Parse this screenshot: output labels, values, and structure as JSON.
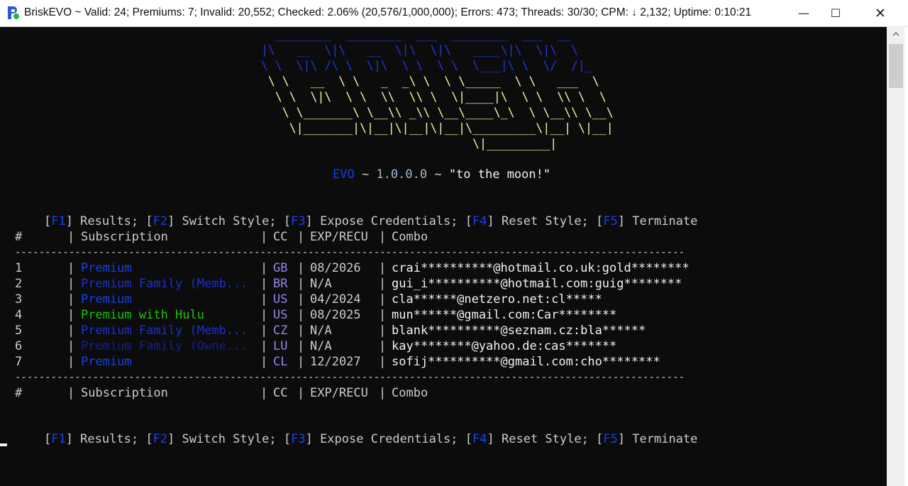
{
  "window": {
    "title": "BriskEVO ~ Valid: 24; Premiums: 7; Invalid: 20,552; Checked: 2.06% (20,576/1,000,000); Errors: 473; Threads: 30/30; CPM: ↓ 2,132; Uptime: 0:10:21",
    "minimize": "—",
    "maximize": "☐",
    "close": "✕"
  },
  "art": {
    "line1": "  ________  ________  ___  ________  ___  __",
    "line2": "|\\   __  \\|\\   __  \\|\\  \\|\\   ____\\|\\  \\|\\  \\",
    "line3": "\\ \\  \\|\\ /\\ \\  \\|\\  \\ \\  \\ \\  \\___|\\ \\  \\/  /|_",
    "line4": " \\ \\   __  \\ \\   _  _\\ \\  \\ \\_____  \\ \\   ___  \\",
    "line5": "  \\ \\  \\|\\  \\ \\  \\\\  \\\\ \\  \\|____|\\  \\ \\  \\\\ \\  \\",
    "line6": "   \\ \\_______\\ \\__\\\\ _\\\\ \\__\\____\\_\\  \\ \\__\\\\ \\__\\",
    "line7": "    \\|_______|\\|__|\\|__|\\|__|\\_________\\|__| \\|__|",
    "line8": "                              \\|_________|"
  },
  "version_line": {
    "evo": "EVO",
    "sep1": " ~ ",
    "version": "1.0.0.0",
    "sep2": " ~ ",
    "motto": "\"to the moon!\""
  },
  "menu": [
    {
      "key": "F1",
      "label": "Results;"
    },
    {
      "key": "F2",
      "label": "Switch Style;"
    },
    {
      "key": "F3",
      "label": "Expose Credentials;"
    },
    {
      "key": "F4",
      "label": "Reset Style;"
    },
    {
      "key": "F5",
      "label": "Terminate"
    }
  ],
  "table": {
    "headers": {
      "num": "#",
      "subscription": "Subscription",
      "cc": "CC",
      "exp": "EXP/RECU",
      "combo": "Combo"
    },
    "divider": "----------------------------------------------------------------------------------------------------------------",
    "rows": [
      {
        "num": "1",
        "subscription": "Premium",
        "cc": "GB",
        "exp": "08/2026",
        "combo": "crai**********@hotmail.co.uk:gold********"
      },
      {
        "num": "2",
        "subscription": "Premium Family (Memb...",
        "cc": "BR",
        "exp": "N/A",
        "combo": "gui_i**********@hotmail.com:guig********"
      },
      {
        "num": "3",
        "subscription": "Premium",
        "cc": "US",
        "exp": "04/2024",
        "combo": "cla******@netzero.net:cl*****"
      },
      {
        "num": "4",
        "subscription": "Premium with Hulu",
        "cc": "US",
        "exp": "08/2025",
        "combo": "mun******@gmail.com:Car********"
      },
      {
        "num": "5",
        "subscription": "Premium Family (Memb...",
        "cc": "CZ",
        "exp": "N/A",
        "combo": "blank**********@seznam.cz:bla******"
      },
      {
        "num": "6",
        "subscription": "Premium Family (Owne...",
        "cc": "LU",
        "exp": "N/A",
        "combo": "kay********@yahoo.de:cas*******"
      },
      {
        "num": "7",
        "subscription": "Premium",
        "cc": "CL",
        "exp": "12/2027",
        "combo": "sofij**********@gmail.com:cho********"
      }
    ]
  },
  "colors": {
    "premium": "#1540e8",
    "family_member": "#1c2fd0",
    "family_owner": "#12208e",
    "hulu": "#16c60c",
    "cc": "#8f86f0",
    "terminal_bg": "#0c0c0c"
  }
}
